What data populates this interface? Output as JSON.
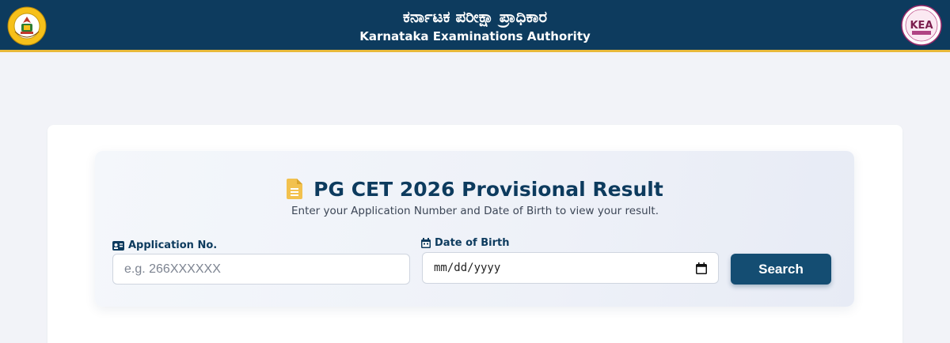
{
  "header": {
    "title_kannada": "ಕರ್ನಾಟಕ ಪರೀಕ್ಷಾ ಪ್ರಾಧಿಕಾರ",
    "title_english": "Karnataka Examinations Authority",
    "left_logo": "karnataka-government-emblem",
    "left_logo_text_top": "GOVERNMENT OF",
    "left_logo_text_bottom": "KARNATAKA",
    "right_logo": "kea-logo",
    "right_logo_text": "KEA"
  },
  "form": {
    "title": "PG CET 2026 Provisional Result",
    "title_icon": "document-icon",
    "subtitle": "Enter your Application Number and Date of Birth to view your result.",
    "application_label": "Application No.",
    "application_icon": "id-card-icon",
    "application_placeholder": "e.g. 266XXXXXX",
    "dob_label": "Date of Birth",
    "dob_icon": "calendar-icon",
    "dob_placeholder": "mm/dd/yyyy",
    "search_label": "Search"
  },
  "colors": {
    "header_bg": "#0d3b5e",
    "header_border": "#e8b93a",
    "accent": "#144d72",
    "icon_yellow": "#f2c14e"
  }
}
